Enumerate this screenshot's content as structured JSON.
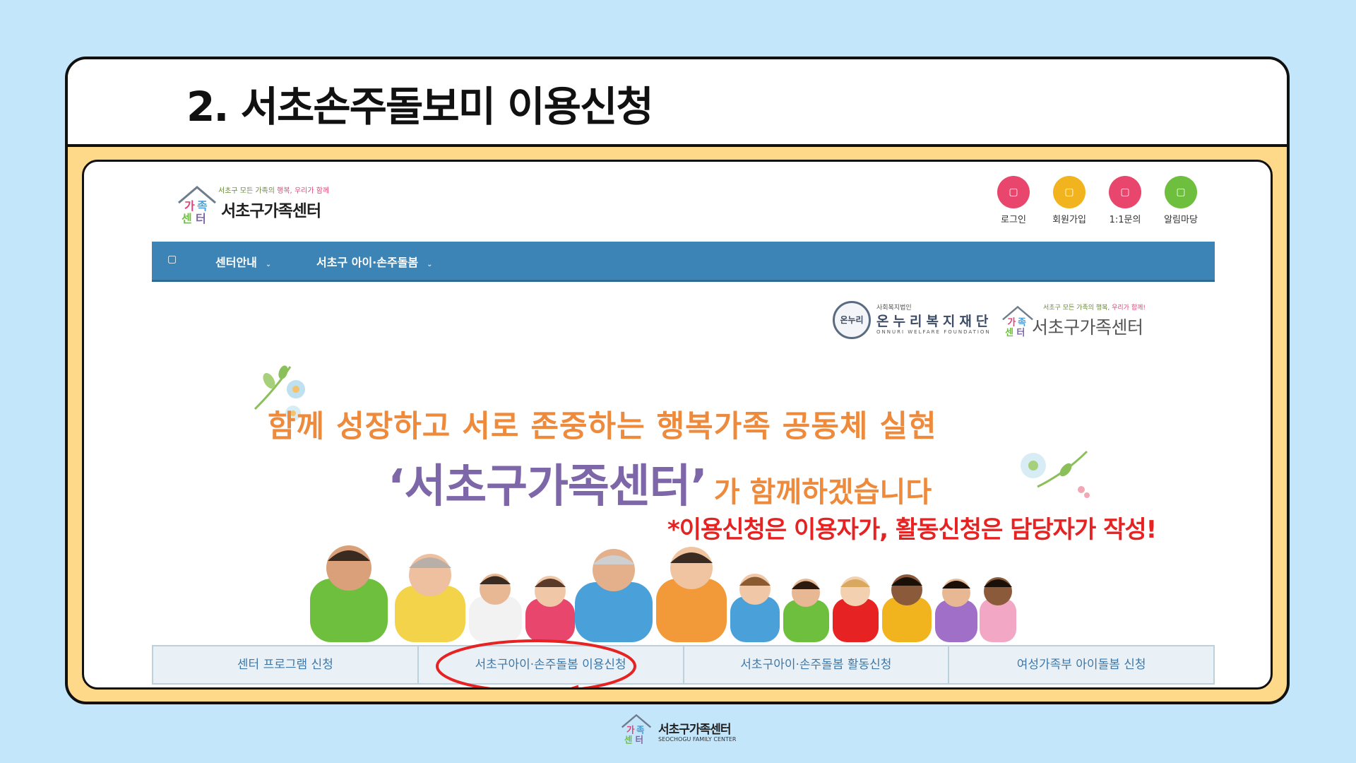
{
  "slide": {
    "title": "2. 서초손주돌보미 이용신청"
  },
  "site": {
    "logo": {
      "tag_prefix": "서초구 모든 가족의",
      "tag_highlight": "행복,",
      "tag_suffix": "우리가 함께",
      "name": "서초구가족센터"
    },
    "quick_links": [
      {
        "label": "로그인",
        "color": "#e8466c",
        "icon": "login-icon"
      },
      {
        "label": "회원가입",
        "color": "#f2b41e",
        "icon": "user-plus-icon"
      },
      {
        "label": "1:1문의",
        "color": "#e8466c",
        "icon": "chat-icon"
      },
      {
        "label": "알림마당",
        "color": "#6fbf3f",
        "icon": "bell-icon"
      }
    ],
    "nav": {
      "home_icon": "home-icon",
      "items": [
        "센터안내",
        "서초구 아이·손주돌봄"
      ]
    },
    "partners": {
      "onnuri_seal": "온누리",
      "onnuri_small": "사회복지법인",
      "onnuri_name": "온누리복지재단",
      "onnuri_en": "ONNURI WELFARE FOUNDATION",
      "center_small_prefix": "서초구 모든 가족의 행복,",
      "center_small_highlight": "우리가 함께!",
      "center_name": "서초구가족센터"
    },
    "banner": {
      "headline": "함께 성장하고 서로 존중하는 행복가족 공동체 실현",
      "subline_main": "‘서초구가족센터’",
      "subline_rest": "가 함께하겠습니다"
    },
    "tabs": [
      "센터 프로그램 신청",
      "서초구아이·손주돌봄 이용신청",
      "서초구아이·손주돌봄 활동신청",
      "여성가족부 아이돌봄 신청"
    ]
  },
  "annotation": {
    "notice": "*이용신청은 이용자가, 활동신청은 담당자가 작성!"
  },
  "footer": {
    "name": "서초구가족센터",
    "en": "SEOCHOGU FAMILY CENTER"
  },
  "colors": {
    "background": "#c4e6fb",
    "frame": "#ffd98a",
    "nav": "#3c84b5",
    "headline": "#ee8a3c",
    "brand_purple": "#7d67a8",
    "notice": "#e62222"
  }
}
